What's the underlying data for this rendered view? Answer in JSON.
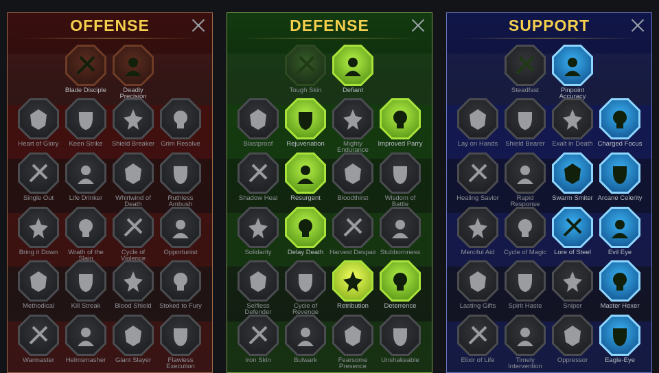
{
  "colors": {
    "title": "#f4d04e",
    "offense_accent": "#8a1e1a",
    "defense_accent": "#a8e23a",
    "support_accent": "#3ab0f0",
    "locked_label": "#8e9196"
  },
  "panels": [
    {
      "key": "offense",
      "title": "OFFENSE",
      "close_icon": "close-icon",
      "talents": [
        {
          "label": "Blade Disciple",
          "icon": "crossed-swords-icon",
          "state": "active"
        },
        {
          "label": "Deadly Precision",
          "icon": "daggers-icon",
          "state": "active"
        },
        {
          "label": "Heart of Glory",
          "icon": "horned-warrior-icon",
          "state": "locked"
        },
        {
          "label": "Keen Strike",
          "icon": "slash-icon",
          "state": "locked"
        },
        {
          "label": "Shield Breaker",
          "icon": "broken-shield-icon",
          "state": "locked"
        },
        {
          "label": "Grim Resolve",
          "icon": "grim-heart-icon",
          "state": "locked"
        },
        {
          "label": "Single Out",
          "icon": "fist-icon",
          "state": "locked"
        },
        {
          "label": "Life Drinker",
          "icon": "fangs-icon",
          "state": "locked"
        },
        {
          "label": "Whirlwind of Death",
          "icon": "whirlwind-icon",
          "state": "locked"
        },
        {
          "label": "Ruthless Ambush",
          "icon": "dagger-hand-icon",
          "state": "locked"
        },
        {
          "label": "Bring it Down",
          "icon": "downward-sword-icon",
          "state": "locked"
        },
        {
          "label": "Wrath of the Slain",
          "icon": "hammer-fist-icon",
          "state": "locked"
        },
        {
          "label": "Cycle of Violence",
          "icon": "axe-icon",
          "state": "locked"
        },
        {
          "label": "Opportunist",
          "icon": "chain-lightning-icon",
          "state": "locked"
        },
        {
          "label": "Methodical",
          "icon": "spider-icon",
          "state": "locked"
        },
        {
          "label": "Kill Streak",
          "icon": "skull-icon",
          "state": "locked"
        },
        {
          "label": "Blood Shield",
          "icon": "shield-sword-icon",
          "state": "locked"
        },
        {
          "label": "Stoked to Fury",
          "icon": "rage-figure-icon",
          "state": "locked"
        },
        {
          "label": "Warmaster",
          "icon": "raised-sword-icon",
          "state": "locked"
        },
        {
          "label": "Helmsmasher",
          "icon": "helmet-icon",
          "state": "locked"
        },
        {
          "label": "Giant Slayer",
          "icon": "giant-icon",
          "state": "locked"
        },
        {
          "label": "Flawless Execution",
          "icon": "skull-axe-icon",
          "state": "locked"
        }
      ]
    },
    {
      "key": "defense",
      "title": "DEFENSE",
      "close_icon": "close-icon",
      "talents": [
        {
          "label": "Tough Skin",
          "icon": "scales-icon",
          "state": "base"
        },
        {
          "label": "Defiant",
          "icon": "raised-fist-icon",
          "state": "active"
        },
        {
          "label": "Blastproof",
          "icon": "chevron-shield-icon",
          "state": "locked"
        },
        {
          "label": "Rejuvenation",
          "icon": "potion-heart-icon",
          "state": "active"
        },
        {
          "label": "Mighty Endurance",
          "icon": "strongman-icon",
          "state": "locked"
        },
        {
          "label": "Improved Parry",
          "icon": "parry-swords-icon",
          "state": "active"
        },
        {
          "label": "Shadow Heal",
          "icon": "kneeling-figure-icon",
          "state": "locked"
        },
        {
          "label": "Resurgent",
          "icon": "knight-shield-icon",
          "state": "active"
        },
        {
          "label": "Bloodthirst",
          "icon": "skull-heart-icon",
          "state": "locked"
        },
        {
          "label": "Wisdom of Battle",
          "icon": "hooded-face-icon",
          "state": "locked"
        },
        {
          "label": "Solidarity",
          "icon": "crowd-icon",
          "state": "locked"
        },
        {
          "label": "Delay Death",
          "icon": "hourglass-icon",
          "state": "active"
        },
        {
          "label": "Harvest Despair",
          "icon": "open-hand-icon",
          "state": "locked"
        },
        {
          "label": "Stubbornness",
          "icon": "bull-icon",
          "state": "locked"
        },
        {
          "label": "Selfless Defender",
          "icon": "runner-icon",
          "state": "locked"
        },
        {
          "label": "Cycle of Revenge",
          "icon": "flames-icon",
          "state": "locked"
        },
        {
          "label": "Retribution",
          "icon": "burning-skull-icon",
          "state": "active-hi"
        },
        {
          "label": "Deterrence",
          "icon": "deflect-icon",
          "state": "active"
        },
        {
          "label": "Iron Skin",
          "icon": "armored-man-icon",
          "state": "locked"
        },
        {
          "label": "Bulwark",
          "icon": "tower-shield-icon",
          "state": "locked"
        },
        {
          "label": "Fearsome Presence",
          "icon": "demon-face-icon",
          "state": "locked"
        },
        {
          "label": "Unshakeable",
          "icon": "flexing-figure-icon",
          "state": "locked"
        }
      ]
    },
    {
      "key": "support",
      "title": "SUPPORT",
      "close_icon": "close-icon",
      "talents": [
        {
          "label": "Steadfast",
          "icon": "sparkle-heart-icon",
          "state": "base"
        },
        {
          "label": "Pinpoint Accuracy",
          "icon": "target-fist-icon",
          "state": "active"
        },
        {
          "label": "Lay on Hands",
          "icon": "praying-hands-icon",
          "state": "locked"
        },
        {
          "label": "Shield Bearer",
          "icon": "ring-shield-icon",
          "state": "locked"
        },
        {
          "label": "Exalt in Death",
          "icon": "smoking-skull-icon",
          "state": "locked"
        },
        {
          "label": "Charged Focus",
          "icon": "energy-hand-icon",
          "state": "active"
        },
        {
          "label": "Healing Savior",
          "icon": "healer-icon",
          "state": "locked"
        },
        {
          "label": "Rapid Response",
          "icon": "lightning-shield-icon",
          "state": "locked"
        },
        {
          "label": "Swarm Smiter",
          "icon": "bolt-strike-icon",
          "state": "active"
        },
        {
          "label": "Arcane Celerity",
          "icon": "speed-figure-icon",
          "state": "active"
        },
        {
          "label": "Merciful Aid",
          "icon": "chained-heart-icon",
          "state": "locked"
        },
        {
          "label": "Cycle of Magic",
          "icon": "fireball-icon",
          "state": "locked"
        },
        {
          "label": "Lore of Steel",
          "icon": "open-book-icon",
          "state": "active"
        },
        {
          "label": "Evil Eye",
          "icon": "radiant-eye-icon",
          "state": "active"
        },
        {
          "label": "Lasting Gifts",
          "icon": "compass-star-icon",
          "state": "locked"
        },
        {
          "label": "Spirit Haste",
          "icon": "winged-boot-icon",
          "state": "locked"
        },
        {
          "label": "Sniper",
          "icon": "eye-icon",
          "state": "locked"
        },
        {
          "label": "Master Hexer",
          "icon": "hexer-icon",
          "state": "active"
        },
        {
          "label": "Elixir of Life",
          "icon": "flask-icon",
          "state": "locked"
        },
        {
          "label": "Timely Intervention",
          "icon": "fanged-skull-icon",
          "state": "locked"
        },
        {
          "label": "Oppressor",
          "icon": "crushing-fist-icon",
          "state": "locked"
        },
        {
          "label": "Eagle-Eye",
          "icon": "eagle-icon",
          "state": "active"
        }
      ]
    }
  ]
}
